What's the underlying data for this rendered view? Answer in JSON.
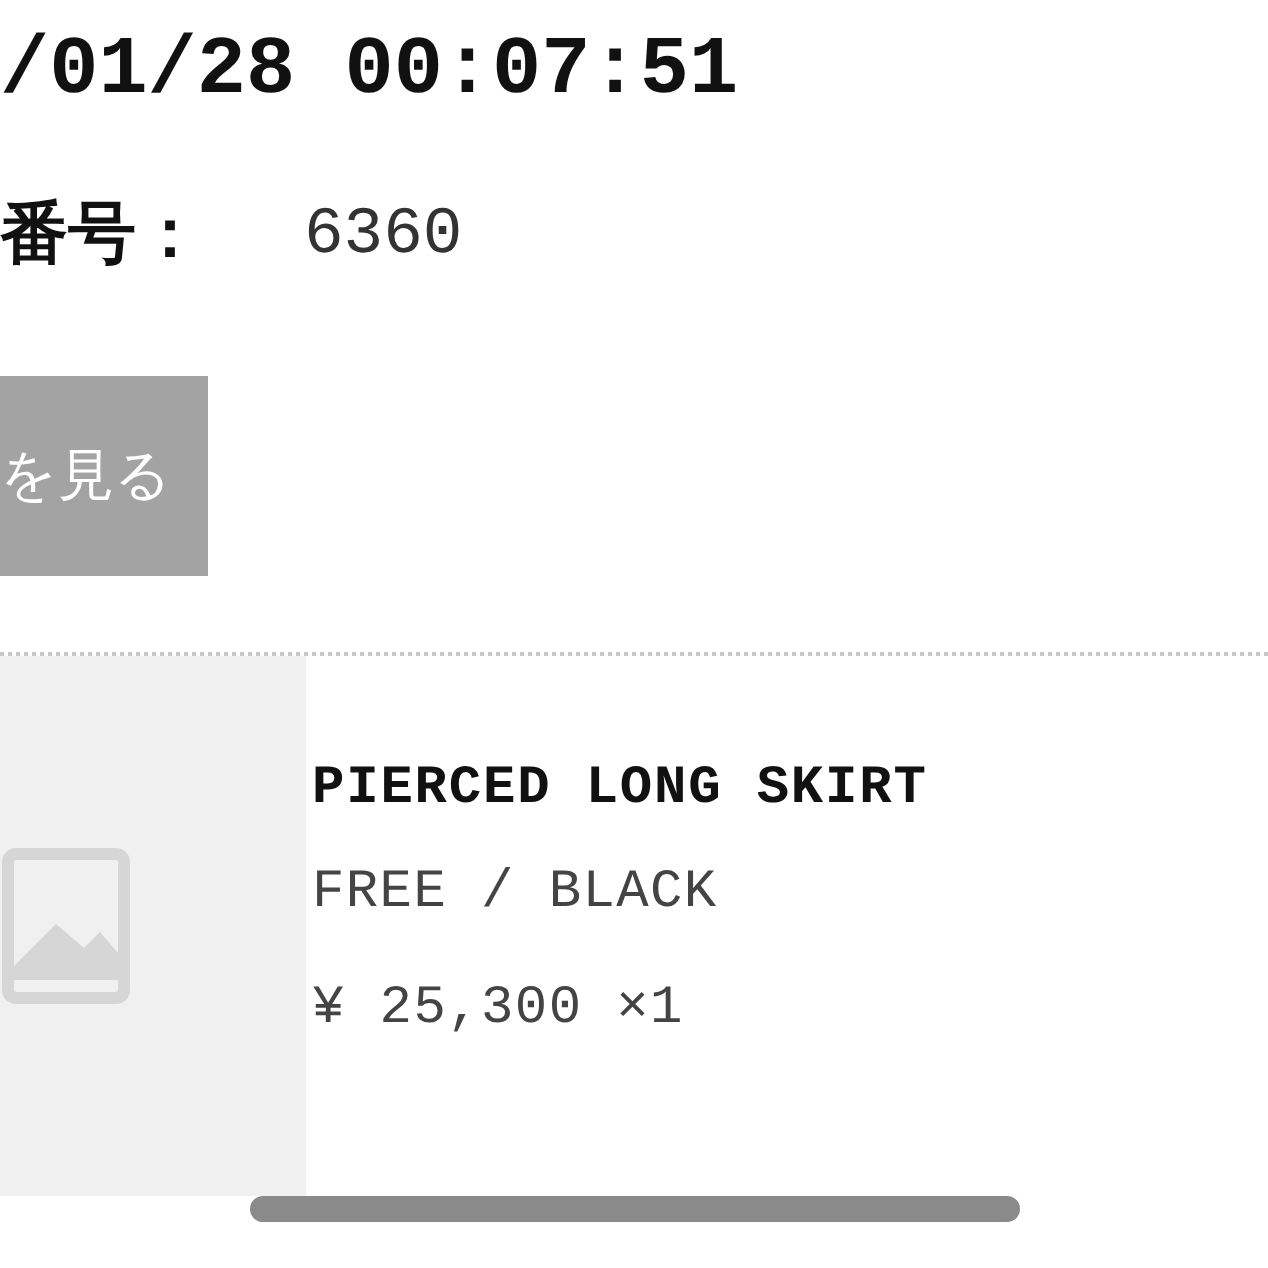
{
  "order": {
    "datetime": "/01/28 00:07:51",
    "number_label": "番号：",
    "number_value": "6360"
  },
  "view_button": {
    "label": "を見る"
  },
  "item": {
    "name": "PIERCED LONG SKIRT",
    "variant": "FREE / BLACK",
    "price": "¥ 25,300 ×1"
  }
}
